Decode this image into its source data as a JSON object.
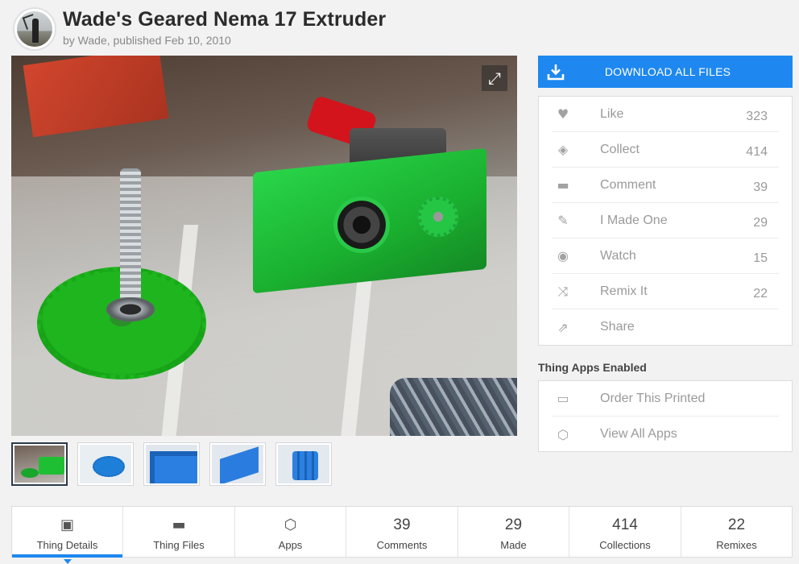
{
  "header": {
    "title": "Wade's Geared Nema 17 Extruder",
    "byline": "by Wade, published Feb 10, 2010"
  },
  "gallery": {
    "expand_icon": "expand-icon",
    "thumbnails": [
      "photo-green-extruder",
      "render-large-gear",
      "render-block",
      "render-bracket",
      "render-small-gear"
    ]
  },
  "download": {
    "label": "DOWNLOAD ALL FILES",
    "icon": "download-icon",
    "color": "#1e88f0"
  },
  "actions": [
    {
      "label": "Like",
      "count": "323",
      "icon": "heart-icon"
    },
    {
      "label": "Collect",
      "count": "414",
      "icon": "collect-icon"
    },
    {
      "label": "Comment",
      "count": "39",
      "icon": "comment-icon"
    },
    {
      "label": "I Made One",
      "count": "29",
      "icon": "edit-icon"
    },
    {
      "label": "Watch",
      "count": "15",
      "icon": "eye-icon"
    },
    {
      "label": "Remix It",
      "count": "22",
      "icon": "shuffle-icon"
    },
    {
      "label": "Share",
      "count": "",
      "icon": "share-icon"
    }
  ],
  "apps": {
    "heading": "Thing Apps Enabled",
    "items": [
      {
        "label": "Order This Printed",
        "icon": "printer-icon"
      },
      {
        "label": "View All Apps",
        "icon": "cube-icon"
      }
    ]
  },
  "tabs": [
    {
      "label": "Thing Details",
      "icon": "details-icon",
      "active": true
    },
    {
      "label": "Thing Files",
      "icon": "folder-icon"
    },
    {
      "label": "Apps",
      "icon": "cube-icon"
    },
    {
      "label": "Comments",
      "count": "39"
    },
    {
      "label": "Made",
      "count": "29"
    },
    {
      "label": "Collections",
      "count": "414"
    },
    {
      "label": "Remixes",
      "count": "22"
    }
  ]
}
